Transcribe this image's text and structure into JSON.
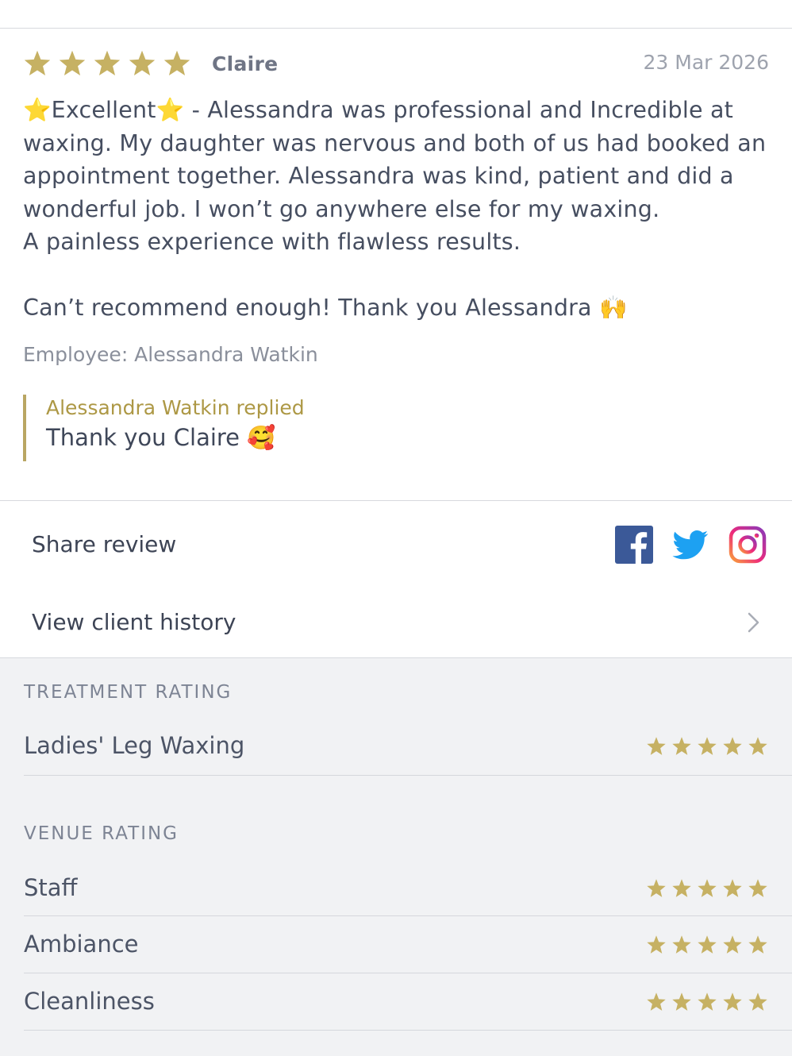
{
  "review": {
    "rating": 5,
    "author": "Claire",
    "date": "23 Mar 2026",
    "body": "⭐Excellent⭐ - Alessandra was professional and Incredible at waxing. My daughter was nervous and both of us had booked an appointment together. Alessandra was kind, patient and did a wonderful job. I won’t go anywhere else for my waxing.\nA painless experience with flawless results.\n\nCan’t recommend enough! Thank you Alessandra 🙌",
    "employee": "Employee: Alessandra Watkin",
    "reply": {
      "name": "Alessandra Watkin replied",
      "text": "Thank you Claire 🥰"
    }
  },
  "share": {
    "label": "Share review",
    "icons": [
      "facebook-icon",
      "twitter-icon",
      "instagram-icon"
    ]
  },
  "history": {
    "label": "View client history"
  },
  "treatment_rating": {
    "title": "TREATMENT RATING",
    "items": [
      {
        "label": "Ladies' Leg Waxing",
        "stars": 5
      }
    ]
  },
  "venue_rating": {
    "title": "VENUE RATING",
    "items": [
      {
        "label": "Staff",
        "stars": 5
      },
      {
        "label": "Ambiance",
        "stars": 5
      },
      {
        "label": "Cleanliness",
        "stars": 5
      }
    ]
  },
  "colors": {
    "star": "#c6b163",
    "reply_accent": "#b9a663",
    "ratings_bg": "#f1f2f4"
  }
}
